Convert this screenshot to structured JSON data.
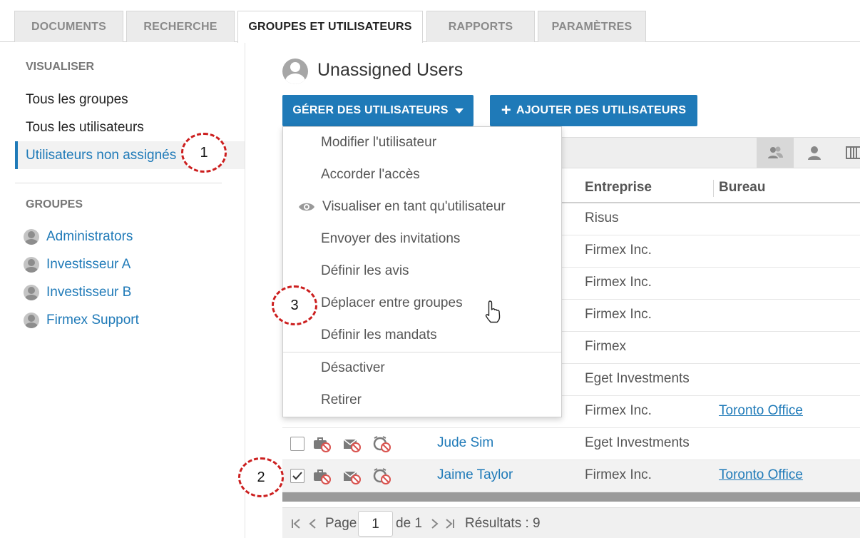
{
  "tabs": [
    {
      "label": "DOCUMENTS",
      "active": false
    },
    {
      "label": "RECHERCHE",
      "active": false
    },
    {
      "label": "GROUPES ET UTILISATEURS",
      "active": true
    },
    {
      "label": "RAPPORTS",
      "active": false
    },
    {
      "label": "PARAMÈTRES",
      "active": false
    }
  ],
  "sidebar": {
    "view_heading": "VISUALISER",
    "view_items": [
      {
        "label": "Tous les groupes",
        "active": false
      },
      {
        "label": "Tous les utilisateurs",
        "active": false
      },
      {
        "label": "Utilisateurs non assignés",
        "active": true
      }
    ],
    "groups_heading": "GROUPES",
    "groups": [
      "Administrators",
      "Investisseur A",
      "Investisseur B",
      "Firmex Support"
    ]
  },
  "main": {
    "title": "Unassigned Users",
    "manage_button": "GÉRER DES UTILISATEURS",
    "add_button": "AJOUTER DES UTILISATEURS",
    "columns": {
      "company": "Entreprise",
      "office": "Bureau"
    },
    "rows": [
      {
        "name": "",
        "company": "Risus",
        "office": "",
        "checked": false
      },
      {
        "name": "",
        "company": "Firmex Inc.",
        "office": "",
        "checked": false
      },
      {
        "name": "",
        "company": "Firmex Inc.",
        "office": "",
        "checked": false
      },
      {
        "name": "",
        "company": "Firmex Inc.",
        "office": "",
        "checked": false
      },
      {
        "name": "",
        "company": "Firmex",
        "office": "",
        "checked": false
      },
      {
        "name": "",
        "company": "Eget Investments",
        "office": "",
        "checked": false
      },
      {
        "name": "",
        "company": "Firmex Inc.",
        "office": "Toronto Office",
        "checked": false
      },
      {
        "name": "Jude Sim",
        "company": "Eget Investments",
        "office": "",
        "checked": false
      },
      {
        "name": "Jaime Taylor",
        "company": "Firmex Inc.",
        "office": "Toronto Office",
        "checked": true
      }
    ]
  },
  "menu": {
    "items": [
      "Modifier l'utilisateur",
      "Accorder l'accès",
      "Visualiser en tant qu'utilisateur",
      "Envoyer des invitations",
      "Définir les avis",
      "Déplacer entre groupes",
      "Définir les mandats",
      "Désactiver",
      "Retirer"
    ]
  },
  "pager": {
    "page_label": "Page",
    "page_value": "1",
    "of_label": "de 1",
    "results": "Résultats : 9"
  },
  "callouts": [
    "1",
    "2",
    "3"
  ],
  "colors": {
    "accent": "#1f7ab8",
    "callout": "#cc1f1f"
  }
}
